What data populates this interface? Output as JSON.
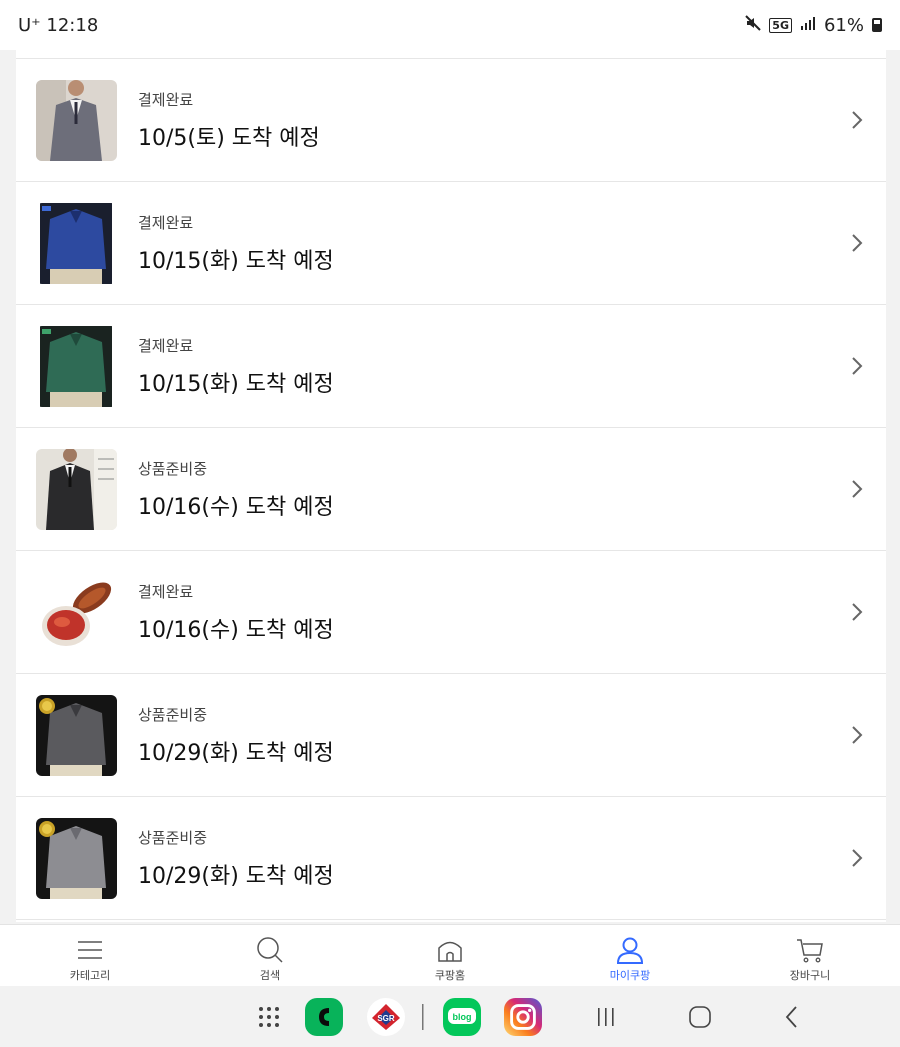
{
  "status_bar": {
    "carrier_time": "U⁺ 12:18",
    "network": "5G",
    "battery": "61%",
    "icons": [
      "mute-icon",
      "network-5g-icon",
      "signal-icon",
      "battery-icon"
    ]
  },
  "orders": [
    {
      "status": "결제완료",
      "arrival": "10/5(토) 도착 예정",
      "thumb": "suit-gray"
    },
    {
      "status": "결제완료",
      "arrival": "10/15(화) 도착 예정",
      "thumb": "shirt-blue"
    },
    {
      "status": "결제완료",
      "arrival": "10/15(화) 도착 예정",
      "thumb": "shirt-green"
    },
    {
      "status": "상품준비중",
      "arrival": "10/16(수) 도착 예정",
      "thumb": "suit-black"
    },
    {
      "status": "결제완료",
      "arrival": "10/16(수) 도착 예정",
      "thumb": "kimchi-dish"
    },
    {
      "status": "상품준비중",
      "arrival": "10/29(화) 도착 예정",
      "thumb": "shirt-dark-gray"
    },
    {
      "status": "상품준비중",
      "arrival": "10/29(화) 도착 예정",
      "thumb": "shirt-light-gray"
    }
  ],
  "tabbar": {
    "tabs": [
      {
        "label": "카테고리",
        "icon": "menu-icon"
      },
      {
        "label": "검색",
        "icon": "search-icon"
      },
      {
        "label": "쿠팡홈",
        "icon": "home-icon"
      },
      {
        "label": "마이쿠팡",
        "icon": "user-icon",
        "active": true
      },
      {
        "label": "장바구니",
        "icon": "cart-icon"
      }
    ],
    "active_color": "#346aff"
  },
  "navbar": {
    "items": [
      "app-drawer-icon",
      "phone-app-icon",
      "sgr-app-icon",
      "blog-app-icon",
      "instagram-app-icon",
      "recent-apps-icon",
      "home-button-icon",
      "back-icon"
    ],
    "blog_label": "blog",
    "sgr_label": "SGR"
  }
}
